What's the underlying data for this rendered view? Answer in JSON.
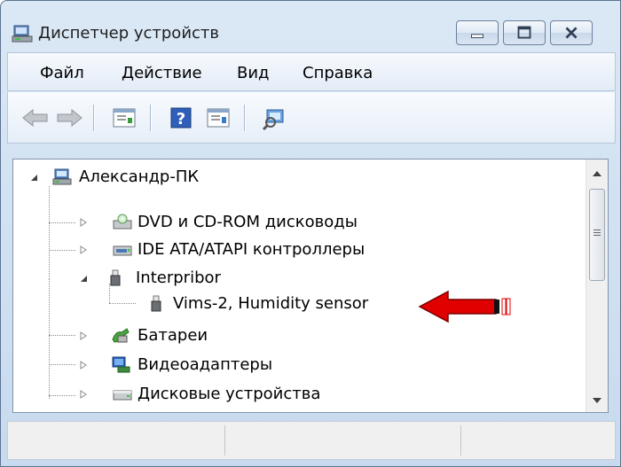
{
  "window": {
    "title": "Диспетчер устройств"
  },
  "menubar": {
    "items": [
      "Файл",
      "Действие",
      "Вид",
      "Справка"
    ]
  },
  "toolbar": {
    "buttons": [
      "back-icon",
      "forward-icon",
      "properties-icon",
      "help-icon",
      "update-driver-icon",
      "scan-hardware-icon"
    ]
  },
  "tree": {
    "root": "Александр-ПК",
    "items": [
      "DVD и CD-ROM дисководы",
      "IDE ATA/ATAPI контроллеры",
      "Interpribor",
      "Vims-2, Humidity sensor",
      "Батареи",
      "Видеоадаптеры",
      "Дисковые устройства"
    ]
  },
  "annotation": {
    "color": "#e00000"
  },
  "status": {
    "segments": [
      "",
      "",
      ""
    ]
  }
}
